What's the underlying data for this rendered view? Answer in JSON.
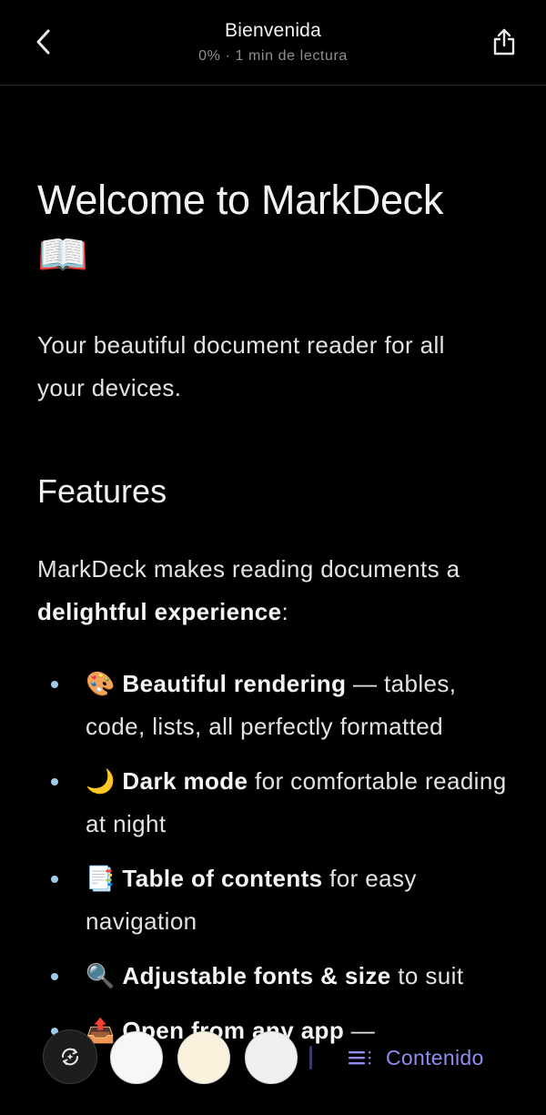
{
  "header": {
    "title": "Bienvenida",
    "subtitle": "0% · 1 min de lectura"
  },
  "document": {
    "h1_text": "Welcome to MarkDeck",
    "h1_emoji": "📖",
    "intro": "Your beautiful document reader for all your devices.",
    "h2": "Features",
    "para_prefix": "MarkDeck makes reading documents a ",
    "para_bold": "delightful experience",
    "para_suffix": ":",
    "features": [
      {
        "emoji": "🎨",
        "bold": "Beautiful rendering",
        "rest": " — tables, code, lists, all perfectly formatted"
      },
      {
        "emoji": "🌙",
        "bold": "Dark mode",
        "rest": " for comfortable reading at night"
      },
      {
        "emoji": "📑",
        "bold": "Table of contents",
        "rest": " for easy navigation"
      },
      {
        "emoji": "🔍",
        "bold": "Adjustable fonts & size",
        "rest": " to suit"
      },
      {
        "emoji": "📤",
        "bold": "Open from any app",
        "rest": " —"
      }
    ]
  },
  "toolbar": {
    "toc_label": "Contenido",
    "swatch_colors": [
      "#f7f7f7",
      "#fbf2de",
      "#f1efef"
    ]
  },
  "colors": {
    "background": "#000000",
    "accent": "#8f8df0",
    "bullet": "#9fcbe8"
  },
  "icons": {
    "back": "chevron-left-icon",
    "share": "share-icon",
    "fab": "auto-theme-icon",
    "toc": "list-icon"
  }
}
